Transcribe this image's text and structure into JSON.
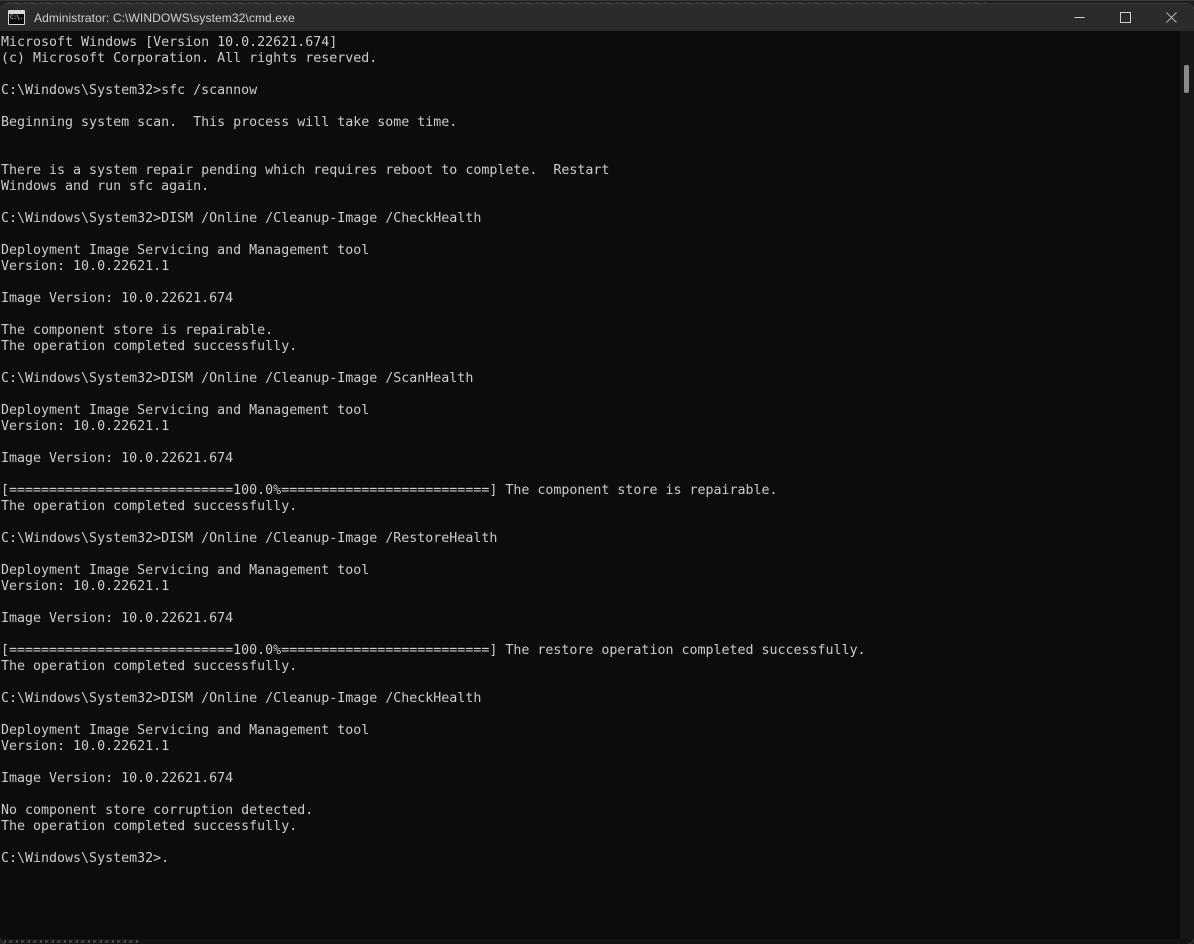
{
  "window": {
    "title": "Administrator: C:\\WINDOWS\\system32\\cmd.exe",
    "icon": "cmd-console-icon",
    "icon_glyph": "C:\\.",
    "titlebar_color": "#2b2b2b",
    "background_color": "#0c0c0c",
    "text_color": "#cccccc"
  },
  "window_controls": {
    "minimize_label": "Minimize",
    "maximize_label": "Maximize",
    "close_label": "Close"
  },
  "scrollbar": {
    "thumb_color": "#8a8a8a",
    "track_color": "#171717"
  },
  "console": {
    "prompt": "C:\\Windows\\System32>",
    "lines": [
      "Microsoft Windows [Version 10.0.22621.674]",
      "(c) Microsoft Corporation. All rights reserved.",
      "",
      "C:\\Windows\\System32>sfc /scannow",
      "",
      "Beginning system scan.  This process will take some time.",
      "",
      "",
      "There is a system repair pending which requires reboot to complete.  Restart",
      "Windows and run sfc again.",
      "",
      "C:\\Windows\\System32>DISM /Online /Cleanup-Image /CheckHealth",
      "",
      "Deployment Image Servicing and Management tool",
      "Version: 10.0.22621.1",
      "",
      "Image Version: 10.0.22621.674",
      "",
      "The component store is repairable.",
      "The operation completed successfully.",
      "",
      "C:\\Windows\\System32>DISM /Online /Cleanup-Image /ScanHealth",
      "",
      "Deployment Image Servicing and Management tool",
      "Version: 10.0.22621.1",
      "",
      "Image Version: 10.0.22621.674",
      "",
      "[============================100.0%==========================] The component store is repairable.",
      "The operation completed successfully.",
      "",
      "C:\\Windows\\System32>DISM /Online /Cleanup-Image /RestoreHealth",
      "",
      "Deployment Image Servicing and Management tool",
      "Version: 10.0.22621.1",
      "",
      "Image Version: 10.0.22621.674",
      "",
      "[============================100.0%==========================] The restore operation completed successfully.",
      "The operation completed successfully.",
      "",
      "C:\\Windows\\System32>DISM /Online /Cleanup-Image /CheckHealth",
      "",
      "Deployment Image Servicing and Management tool",
      "Version: 10.0.22621.1",
      "",
      "Image Version: 10.0.22621.674",
      "",
      "No component store corruption detected.",
      "The operation completed successfully.",
      "",
      "C:\\Windows\\System32>."
    ],
    "commands_run": [
      "sfc /scannow",
      "DISM /Online /Cleanup-Image /CheckHealth",
      "DISM /Online /Cleanup-Image /ScanHealth",
      "DISM /Online /Cleanup-Image /RestoreHealth",
      "DISM /Online /Cleanup-Image /CheckHealth"
    ],
    "progress_percent": "100.0%"
  }
}
